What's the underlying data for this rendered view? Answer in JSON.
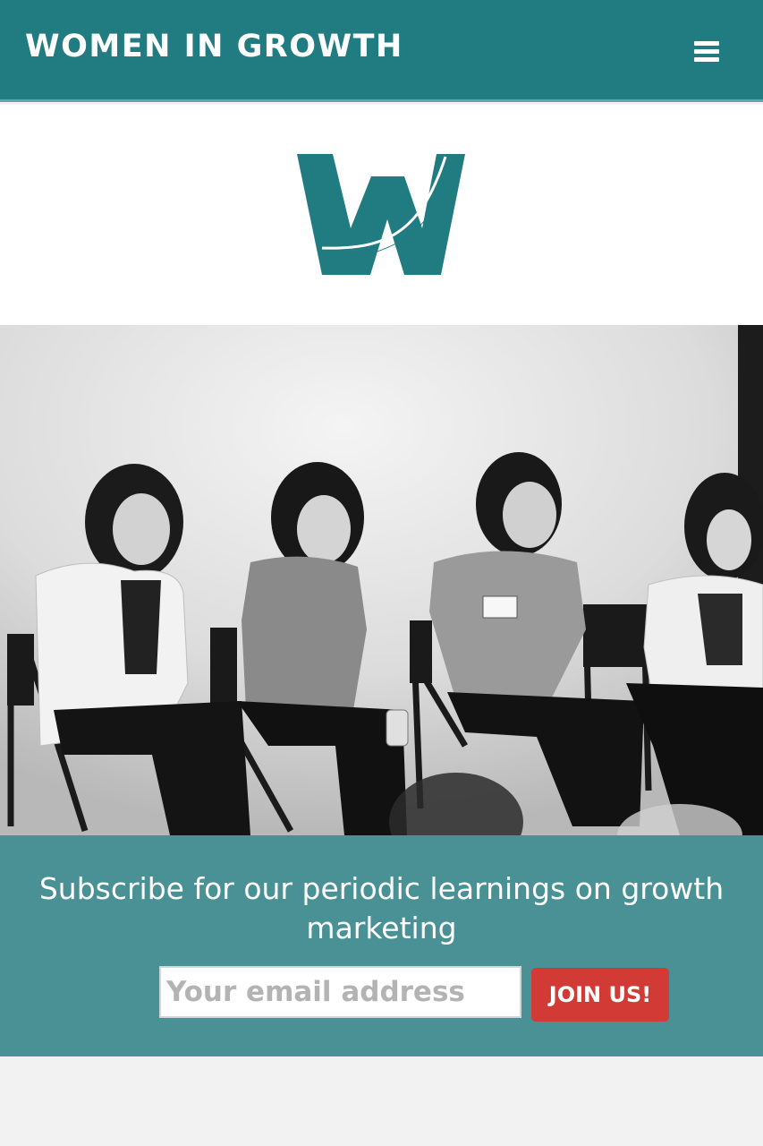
{
  "header": {
    "brand": "WOMEN IN GROWTH",
    "menu_icon": "hamburger-menu-icon",
    "background_color": "#217c82"
  },
  "logo": {
    "letter": "W",
    "color": "#217c82"
  },
  "hero": {
    "image": "black-and-white photo of four women seated on chairs on a panel stage, smiling"
  },
  "subscribe": {
    "heading": "Subscribe for our periodic learnings on growth marketing",
    "email_placeholder": "Your email address",
    "email_value": "",
    "join_label": "JOIN US!",
    "background_color": "#4a9196",
    "button_color": "#d23a35"
  }
}
